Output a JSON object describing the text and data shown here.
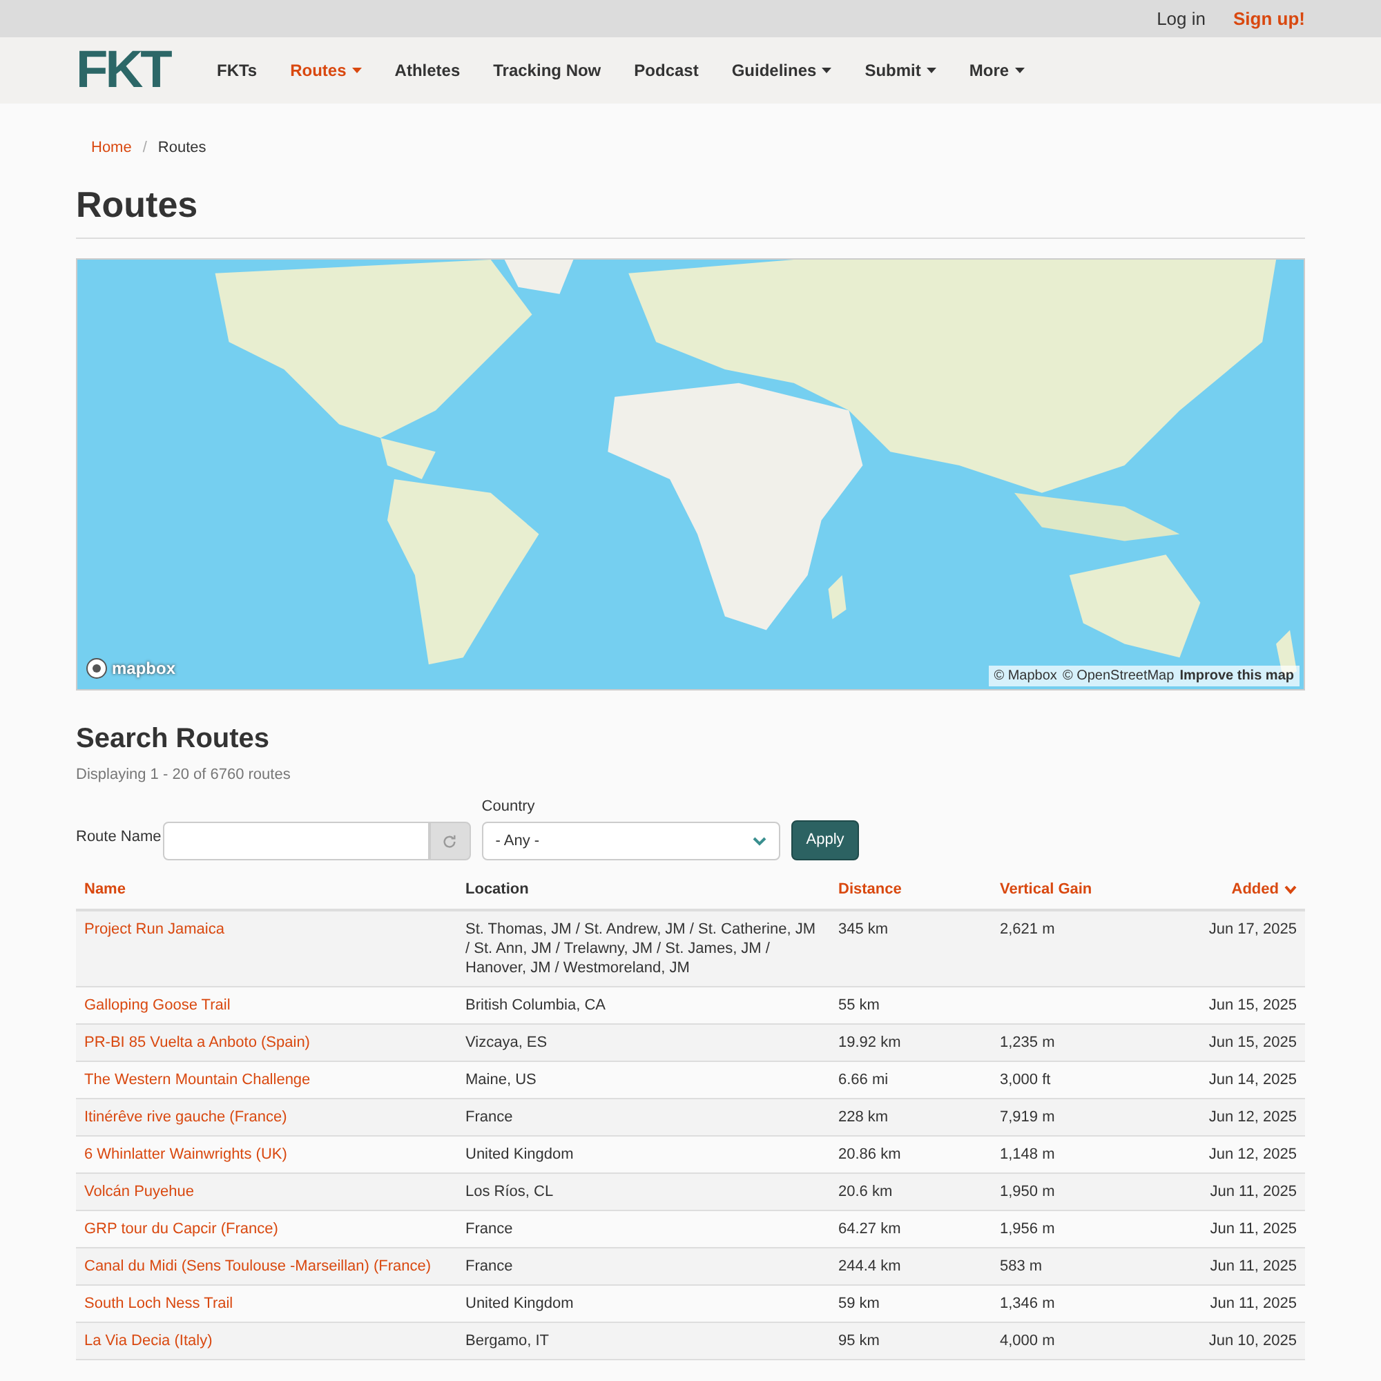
{
  "top_bar": {
    "links": [
      {
        "label": "Log in",
        "kind": "plain"
      },
      {
        "label": "Sign up!",
        "kind": "accent"
      }
    ]
  },
  "nav": {
    "logo": "FKT",
    "items": [
      {
        "label": "FKTs",
        "selected": false,
        "dropdown": false
      },
      {
        "label": "Routes",
        "selected": true,
        "dropdown": true
      },
      {
        "label": "Athletes",
        "selected": false,
        "dropdown": false
      },
      {
        "label": "Tracking Now",
        "selected": false,
        "dropdown": false
      },
      {
        "label": "Podcast",
        "selected": false,
        "dropdown": false
      },
      {
        "label": "Guidelines",
        "selected": false,
        "dropdown": true
      },
      {
        "label": "Submit",
        "selected": false,
        "dropdown": true
      },
      {
        "label": "More",
        "selected": false,
        "dropdown": true
      }
    ]
  },
  "breadcrumb": {
    "separator": "/",
    "items": [
      "Home",
      "Routes"
    ]
  },
  "title": "Routes",
  "map": {
    "logo_text": "mapbox",
    "attribution": [
      "© Mapbox",
      "© OpenStreetMap",
      "Improve this map"
    ]
  },
  "search": {
    "title": "Search Routes",
    "summary": "Displaying 1 - 20 of 6760 routes",
    "route_name_label": "Route Name",
    "country_label": "Country",
    "country_value": "- Any -",
    "apply": "Apply"
  },
  "table": {
    "columns": [
      {
        "label": "Name",
        "sortable": true,
        "sorted": false
      },
      {
        "label": "Location",
        "sortable": false,
        "sorted": false
      },
      {
        "label": "Distance",
        "sortable": true,
        "sorted": false
      },
      {
        "label": "Vertical Gain",
        "sortable": true,
        "sorted": false
      },
      {
        "label": "Added",
        "sortable": true,
        "sorted": true
      }
    ],
    "rows": [
      [
        "Project Run Jamaica",
        "St. Thomas, JM / St. Andrew, JM / St. Catherine, JM / St. Ann, JM / Trelawny, JM / St. James, JM / Hanover, JM / Westmoreland, JM",
        "345 km",
        "2,621 m",
        "Jun 17, 2025"
      ],
      [
        "Galloping Goose Trail",
        "British Columbia, CA",
        "55 km",
        "",
        "Jun 15, 2025"
      ],
      [
        "PR-BI 85 Vuelta a Anboto (Spain)",
        "Vizcaya, ES",
        "19.92 km",
        "1,235 m",
        "Jun 15, 2025"
      ],
      [
        "The Western Mountain Challenge",
        "Maine, US",
        "6.66 mi",
        "3,000 ft",
        "Jun 14, 2025"
      ],
      [
        "Itinérêve rive gauche (France)",
        "France",
        "228 km",
        "7,919 m",
        "Jun 12, 2025"
      ],
      [
        "6 Whinlatter Wainwrights (UK)",
        "United Kingdom",
        "20.86 km",
        "1,148 m",
        "Jun 12, 2025"
      ],
      [
        "Volcán Puyehue",
        "Los Ríos, CL",
        "20.6 km",
        "1,950 m",
        "Jun 11, 2025"
      ],
      [
        "GRP tour du Capcir (France)",
        "France",
        "64.27 km",
        "1,956 m",
        "Jun 11, 2025"
      ],
      [
        "Canal du Midi (Sens Toulouse -Marseillan) (France)",
        "France",
        "244.4 km",
        "583 m",
        "Jun 11, 2025"
      ],
      [
        "South Loch Ness Trail",
        "United Kingdom",
        "59 km",
        "1,346 m",
        "Jun 11, 2025"
      ],
      [
        "La Via Decia (Italy)",
        "Bergamo, IT",
        "95 km",
        "4,000 m",
        "Jun 10, 2025"
      ]
    ]
  }
}
